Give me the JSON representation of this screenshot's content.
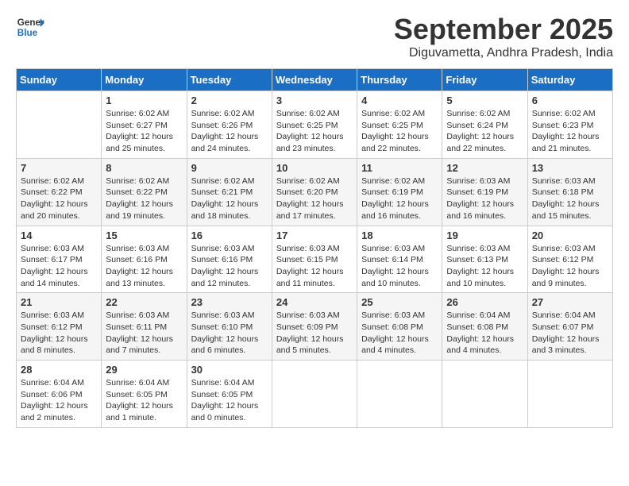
{
  "logo": {
    "line1": "General",
    "line2": "Blue"
  },
  "title": "September 2025",
  "location": "Diguvametta, Andhra Pradesh, India",
  "weekdays": [
    "Sunday",
    "Monday",
    "Tuesday",
    "Wednesday",
    "Thursday",
    "Friday",
    "Saturday"
  ],
  "weeks": [
    [
      {
        "day": "",
        "detail": ""
      },
      {
        "day": "1",
        "detail": "Sunrise: 6:02 AM\nSunset: 6:27 PM\nDaylight: 12 hours\nand 25 minutes."
      },
      {
        "day": "2",
        "detail": "Sunrise: 6:02 AM\nSunset: 6:26 PM\nDaylight: 12 hours\nand 24 minutes."
      },
      {
        "day": "3",
        "detail": "Sunrise: 6:02 AM\nSunset: 6:25 PM\nDaylight: 12 hours\nand 23 minutes."
      },
      {
        "day": "4",
        "detail": "Sunrise: 6:02 AM\nSunset: 6:25 PM\nDaylight: 12 hours\nand 22 minutes."
      },
      {
        "day": "5",
        "detail": "Sunrise: 6:02 AM\nSunset: 6:24 PM\nDaylight: 12 hours\nand 22 minutes."
      },
      {
        "day": "6",
        "detail": "Sunrise: 6:02 AM\nSunset: 6:23 PM\nDaylight: 12 hours\nand 21 minutes."
      }
    ],
    [
      {
        "day": "7",
        "detail": "Sunrise: 6:02 AM\nSunset: 6:22 PM\nDaylight: 12 hours\nand 20 minutes."
      },
      {
        "day": "8",
        "detail": "Sunrise: 6:02 AM\nSunset: 6:22 PM\nDaylight: 12 hours\nand 19 minutes."
      },
      {
        "day": "9",
        "detail": "Sunrise: 6:02 AM\nSunset: 6:21 PM\nDaylight: 12 hours\nand 18 minutes."
      },
      {
        "day": "10",
        "detail": "Sunrise: 6:02 AM\nSunset: 6:20 PM\nDaylight: 12 hours\nand 17 minutes."
      },
      {
        "day": "11",
        "detail": "Sunrise: 6:02 AM\nSunset: 6:19 PM\nDaylight: 12 hours\nand 16 minutes."
      },
      {
        "day": "12",
        "detail": "Sunrise: 6:03 AM\nSunset: 6:19 PM\nDaylight: 12 hours\nand 16 minutes."
      },
      {
        "day": "13",
        "detail": "Sunrise: 6:03 AM\nSunset: 6:18 PM\nDaylight: 12 hours\nand 15 minutes."
      }
    ],
    [
      {
        "day": "14",
        "detail": "Sunrise: 6:03 AM\nSunset: 6:17 PM\nDaylight: 12 hours\nand 14 minutes."
      },
      {
        "day": "15",
        "detail": "Sunrise: 6:03 AM\nSunset: 6:16 PM\nDaylight: 12 hours\nand 13 minutes."
      },
      {
        "day": "16",
        "detail": "Sunrise: 6:03 AM\nSunset: 6:16 PM\nDaylight: 12 hours\nand 12 minutes."
      },
      {
        "day": "17",
        "detail": "Sunrise: 6:03 AM\nSunset: 6:15 PM\nDaylight: 12 hours\nand 11 minutes."
      },
      {
        "day": "18",
        "detail": "Sunrise: 6:03 AM\nSunset: 6:14 PM\nDaylight: 12 hours\nand 10 minutes."
      },
      {
        "day": "19",
        "detail": "Sunrise: 6:03 AM\nSunset: 6:13 PM\nDaylight: 12 hours\nand 10 minutes."
      },
      {
        "day": "20",
        "detail": "Sunrise: 6:03 AM\nSunset: 6:12 PM\nDaylight: 12 hours\nand 9 minutes."
      }
    ],
    [
      {
        "day": "21",
        "detail": "Sunrise: 6:03 AM\nSunset: 6:12 PM\nDaylight: 12 hours\nand 8 minutes."
      },
      {
        "day": "22",
        "detail": "Sunrise: 6:03 AM\nSunset: 6:11 PM\nDaylight: 12 hours\nand 7 minutes."
      },
      {
        "day": "23",
        "detail": "Sunrise: 6:03 AM\nSunset: 6:10 PM\nDaylight: 12 hours\nand 6 minutes."
      },
      {
        "day": "24",
        "detail": "Sunrise: 6:03 AM\nSunset: 6:09 PM\nDaylight: 12 hours\nand 5 minutes."
      },
      {
        "day": "25",
        "detail": "Sunrise: 6:03 AM\nSunset: 6:08 PM\nDaylight: 12 hours\nand 4 minutes."
      },
      {
        "day": "26",
        "detail": "Sunrise: 6:04 AM\nSunset: 6:08 PM\nDaylight: 12 hours\nand 4 minutes."
      },
      {
        "day": "27",
        "detail": "Sunrise: 6:04 AM\nSunset: 6:07 PM\nDaylight: 12 hours\nand 3 minutes."
      }
    ],
    [
      {
        "day": "28",
        "detail": "Sunrise: 6:04 AM\nSunset: 6:06 PM\nDaylight: 12 hours\nand 2 minutes."
      },
      {
        "day": "29",
        "detail": "Sunrise: 6:04 AM\nSunset: 6:05 PM\nDaylight: 12 hours\nand 1 minute."
      },
      {
        "day": "30",
        "detail": "Sunrise: 6:04 AM\nSunset: 6:05 PM\nDaylight: 12 hours\nand 0 minutes."
      },
      {
        "day": "",
        "detail": ""
      },
      {
        "day": "",
        "detail": ""
      },
      {
        "day": "",
        "detail": ""
      },
      {
        "day": "",
        "detail": ""
      }
    ]
  ]
}
